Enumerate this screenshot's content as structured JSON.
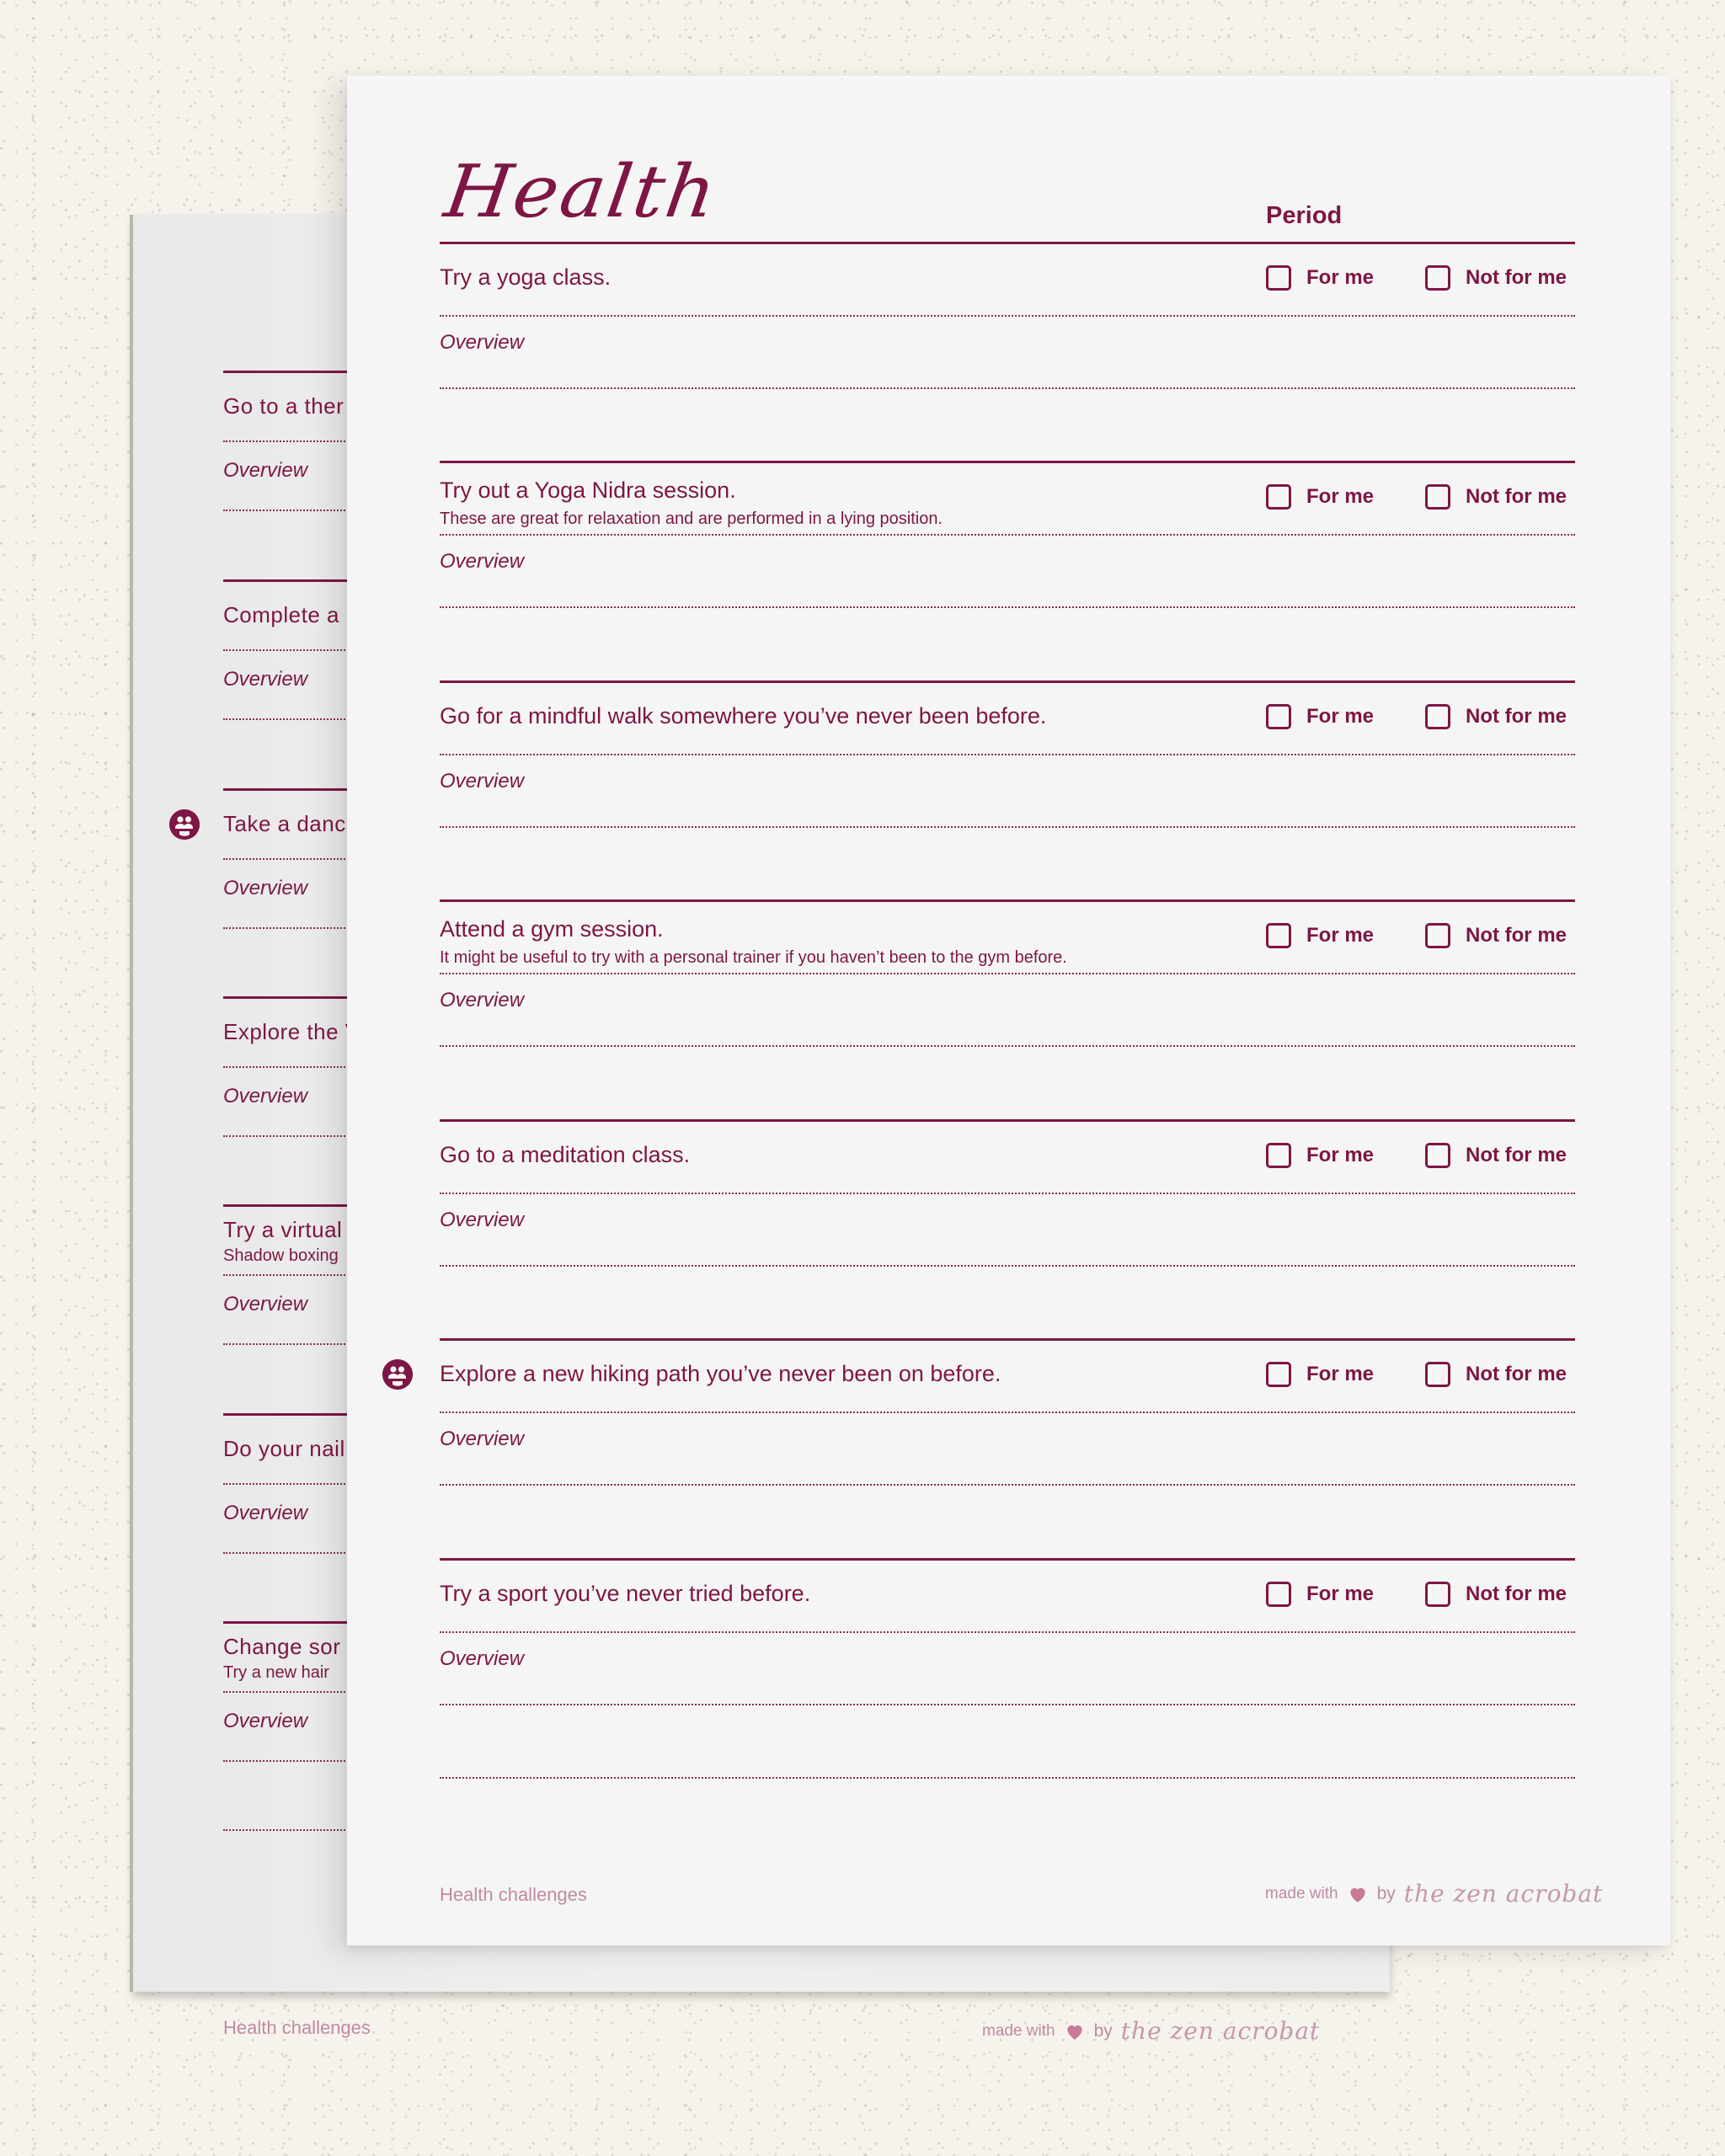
{
  "front_page": {
    "title": "Health",
    "period_label": "Period",
    "option_labels": {
      "for_me": "For me",
      "not_for_me": "Not for me"
    },
    "overview_label": "Overview",
    "items": [
      {
        "task": "Try a yoga class.",
        "subtext": null,
        "group_icon": false,
        "for_me": false,
        "not_for_me": false
      },
      {
        "task": "Try out a Yoga Nidra session.",
        "subtext": "These are great for relaxation and are performed in a lying position.",
        "group_icon": false,
        "for_me": false,
        "not_for_me": false
      },
      {
        "task": "Go for a mindful walk somewhere you’ve never been before.",
        "subtext": null,
        "group_icon": false,
        "for_me": false,
        "not_for_me": false
      },
      {
        "task": "Attend a gym session.",
        "subtext": "It might be useful to try with a personal trainer if you haven’t been to the gym before.",
        "group_icon": false,
        "for_me": false,
        "not_for_me": false
      },
      {
        "task": "Go to a meditation class.",
        "subtext": null,
        "group_icon": false,
        "for_me": false,
        "not_for_me": false
      },
      {
        "task": "Explore a new hiking path you’ve never been on before.",
        "subtext": null,
        "group_icon": true,
        "for_me": false,
        "not_for_me": false
      },
      {
        "task": "Try a sport you’ve never tried before.",
        "subtext": null,
        "group_icon": false,
        "for_me": false,
        "not_for_me": false
      }
    ],
    "footer": {
      "left": "Health challenges",
      "made_with": "made with",
      "by": "by",
      "brand": "the zen acrobat"
    }
  },
  "back_page": {
    "overview_label": "Overview",
    "items": [
      {
        "task": "Go to a ther",
        "subtext": null,
        "group_icon": false
      },
      {
        "task": "Complete a",
        "subtext": null,
        "group_icon": false
      },
      {
        "task": "Take a danc",
        "subtext": null,
        "group_icon": true
      },
      {
        "task": "Explore the V",
        "subtext": null,
        "group_icon": false
      },
      {
        "task": "Try a virtual",
        "subtext": "Shadow boxing",
        "group_icon": false
      },
      {
        "task": "Do your nail",
        "subtext": null,
        "group_icon": false
      },
      {
        "task": "Change sor",
        "subtext": "Try a new hair",
        "group_icon": false
      }
    ],
    "footer": {
      "left": "Health challenges",
      "made_with": "made with",
      "by": "by",
      "brand": "the zen acrobat"
    }
  },
  "colors": {
    "accent": "#7d1645",
    "footer_pink": "#c08aa3",
    "background": "#f6f3ec",
    "front_paper": "#f5f5f5",
    "back_paper": "#ececec"
  }
}
